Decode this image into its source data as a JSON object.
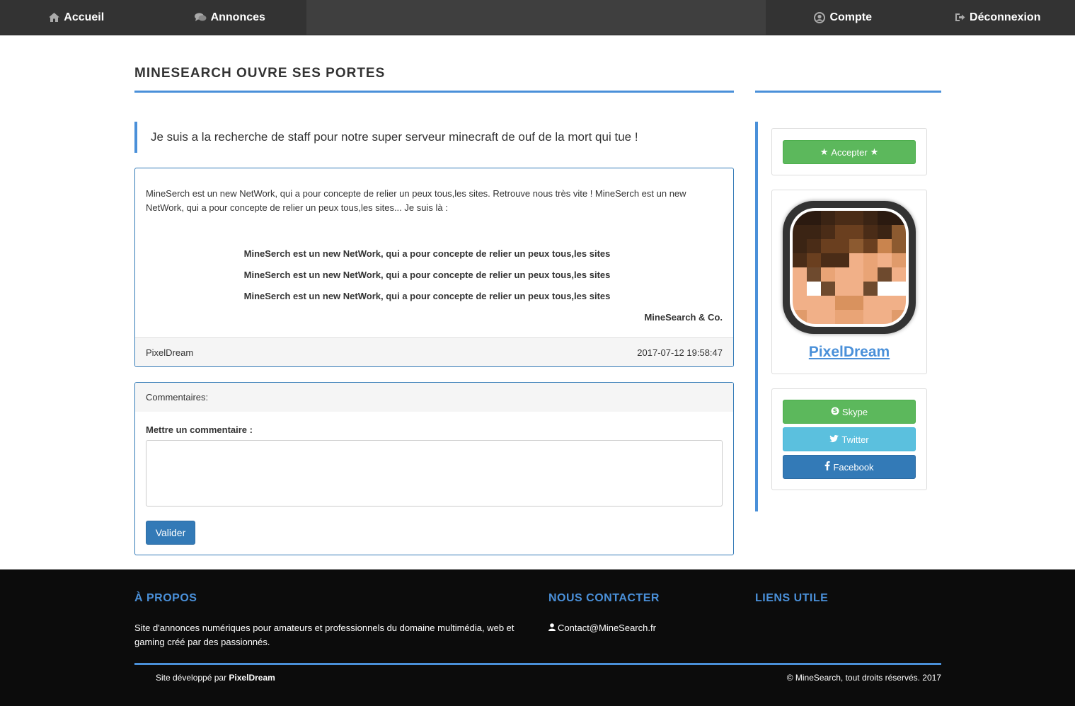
{
  "nav": {
    "left": [
      {
        "label": "Accueil",
        "icon": "home-icon"
      },
      {
        "label": "Annonces",
        "icon": "comments-icon"
      }
    ],
    "right": [
      {
        "label": "Compte",
        "icon": "user-circle-icon"
      },
      {
        "label": "Déconnexion",
        "icon": "sign-out-icon"
      }
    ]
  },
  "post": {
    "title": "MINESEARCH OUVRE SES PORTES",
    "lead": "Je suis a la recherche de staff pour notre super serveur minecraft de ouf de la mort qui tue !",
    "intro": "MineSerch est un new NetWork, qui a pour concepte de relier un peux tous,les sites. Retrouve nous très vite ! MineSerch est un new NetWork, qui a pour concepte de relier un peux tous,les sites... Je suis là :",
    "quote_lines": [
      "MineSerch est un new NetWork, qui a pour concepte de relier un peux tous,les sites",
      "MineSerch est un new NetWork, qui a pour concepte de relier un peux tous,les sites",
      "MineSerch est un new NetWork, qui a pour concepte de relier un peux tous,les sites"
    ],
    "signature": "MineSearch & Co.",
    "author": "PixelDream",
    "date": "2017-07-12 19:58:47"
  },
  "comments": {
    "heading": "Commentaires:",
    "label": "Mettre un commentaire :",
    "value": "",
    "submit": "Valider"
  },
  "sidebar": {
    "accept_label": "Accepter",
    "profile_name": "PixelDream",
    "social": {
      "skype": "Skype",
      "twitter": "Twitter",
      "facebook": "Facebook"
    }
  },
  "footer": {
    "about_title": "À PROPOS",
    "about_text": "Site d'annonces numériques pour amateurs et professionnels du domaine multimédia, web et gaming créé par des passionnés.",
    "contact_title": "NOUS CONTACTER",
    "contact_email": "Contact@MineSearch.fr",
    "links_title": "LIENS UTILE",
    "dev_prefix": "Site développé par",
    "dev_name": "PixelDream",
    "copyright": "© MineSearch, tout droits réservés. 2017"
  },
  "colors": {
    "accent": "#4a90d9",
    "nav_bg": "#333333",
    "primary": "#337ab7",
    "success": "#5cb85c",
    "info": "#5bc0de",
    "footer_bg": "#0c0c0c"
  }
}
